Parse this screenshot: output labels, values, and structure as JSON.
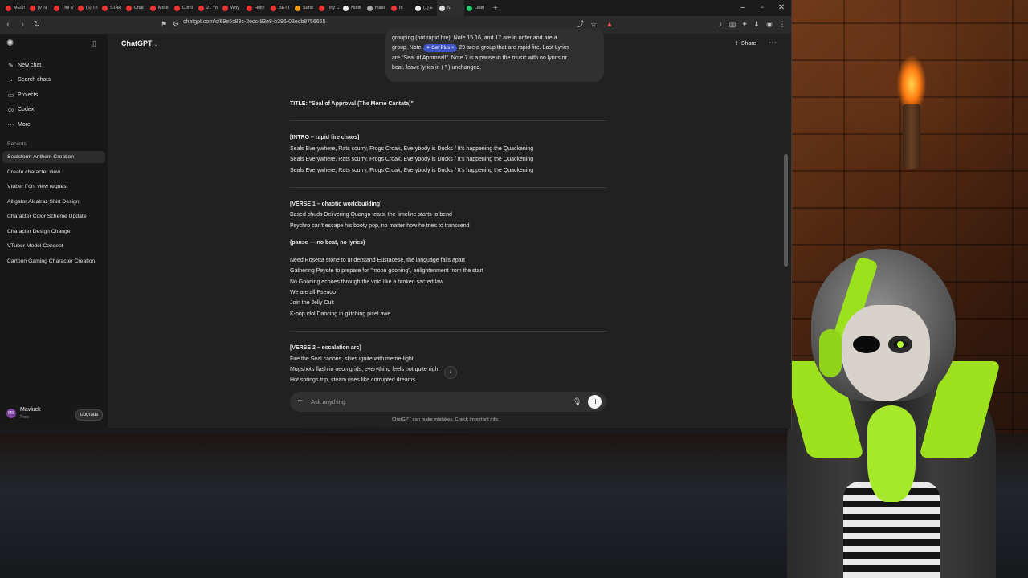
{
  "tabs": [
    {
      "label": "MEO!",
      "color": "#e33"
    },
    {
      "label": "[VTu",
      "color": "#e33"
    },
    {
      "label": "The V",
      "color": "#e33"
    },
    {
      "label": "(6) Th",
      "color": "#e33"
    },
    {
      "label": "STAR",
      "color": "#e33"
    },
    {
      "label": "Chat",
      "color": "#e33"
    },
    {
      "label": "More",
      "color": "#e33"
    },
    {
      "label": "Comi",
      "color": "#e33"
    },
    {
      "label": "21 Yo",
      "color": "#e33"
    },
    {
      "label": "Why",
      "color": "#e33"
    },
    {
      "label": "Holly",
      "color": "#e33"
    },
    {
      "label": "BETT",
      "color": "#e33"
    },
    {
      "label": "Suno",
      "color": "#f39c12"
    },
    {
      "label": "Tiny C",
      "color": "#e33"
    },
    {
      "label": "Notifi",
      "color": "#eee"
    },
    {
      "label": "mass",
      "color": "#aaa"
    },
    {
      "label": "In",
      "color": "#e33"
    },
    {
      "label": "(1) E",
      "color": "#eee"
    },
    {
      "label": "S",
      "color": "#ddd"
    },
    {
      "label": "Leafl",
      "color": "#2ecc71"
    }
  ],
  "toolbar": {
    "url": "chatgpt.com/c/69e5c83c-2ecc-83e8-b396-03ecb8756665"
  },
  "sidebar": {
    "nav": [
      {
        "label": "New chat",
        "icon": "✎"
      },
      {
        "label": "Search chats",
        "icon": "⌕"
      },
      {
        "label": "Projects",
        "icon": "▭"
      },
      {
        "label": "Codex",
        "icon": "◎"
      },
      {
        "label": "More",
        "icon": "···"
      }
    ],
    "recents_label": "Recents",
    "recents": [
      "Sealstorm Anthem Creation",
      "Create character view",
      "Vtuber front view request",
      "Alligator Alcatraz Shirt Design",
      "Character Color Scheme Update",
      "Character Design Change",
      "VTuber Model Concept",
      "Cartoon Gaming Character Creation"
    ],
    "user": {
      "initials": "MR",
      "name": "Mavluck",
      "plan": "Free",
      "upgrade": "Upgrade"
    }
  },
  "header": {
    "model": "ChatGPT",
    "share": "Share"
  },
  "user_message": {
    "line1": "grouping (not rapid fire). Note 15,16, and 17 are in order and are a",
    "line2a": "group. Note",
    "get_plus": "✦ Get Plus ×",
    "line2b": " 29 are a group that are rapid fire. Last Lyrics",
    "line3": "are \"Seal of Approval!\". Note 7 is a pause in the music with no lyrics or",
    "line4": "beat. leave lyrics in ( \" ) unchanged."
  },
  "response": {
    "title": "TITLE: \"Seal of Approval (The Meme Cantata)\"",
    "intro_head": "[INTRO – rapid fire chaos]",
    "intro_lines": [
      "Seals Everywhere, Rats scurry, Frogs Croak, Everybody is Ducks / It's happening the Quackening",
      "Seals Everywhere, Rats scurry, Frogs Croak, Everybody is Ducks / It's happening the Quackening",
      "Seals Everywhere, Rats scurry, Frogs Croak, Everybody is Ducks / It's happening the Quackening"
    ],
    "verse1_head": "[VERSE 1 – chaotic worldbuilding]",
    "verse1_lines": [
      "Based chuds Delivering Quango tears, the timeline starts to bend",
      "Psychro can't escape his booty pop, no matter how he tries to transcend"
    ],
    "pause": "(pause — no beat, no lyrics)",
    "verse1b_lines": [
      "Need Rosetta stone to understand Eustacese, the language falls apart",
      "Gathering Peyote to prepare for \"moon gooning\", enlightenment from the start",
      "No Gooning echoes through the void like a broken sacred law",
      "We are all Pseudo",
      "Join the Jelly Cult",
      "K-pop idol Dancing in glitching pixel awe"
    ],
    "verse2_head": "[VERSE 2 – escalation arc]",
    "verse2_lines": [
      "Fire the Seal canons, skies ignite with meme-light",
      "Mugshots flash in neon grids, everything feels not quite right",
      "Hot springs trip, steam rises like corrupted dreams"
    ]
  },
  "composer": {
    "placeholder": "Ask anything"
  },
  "disclaimer": "ChatGPT can make mistakes. Check important info."
}
